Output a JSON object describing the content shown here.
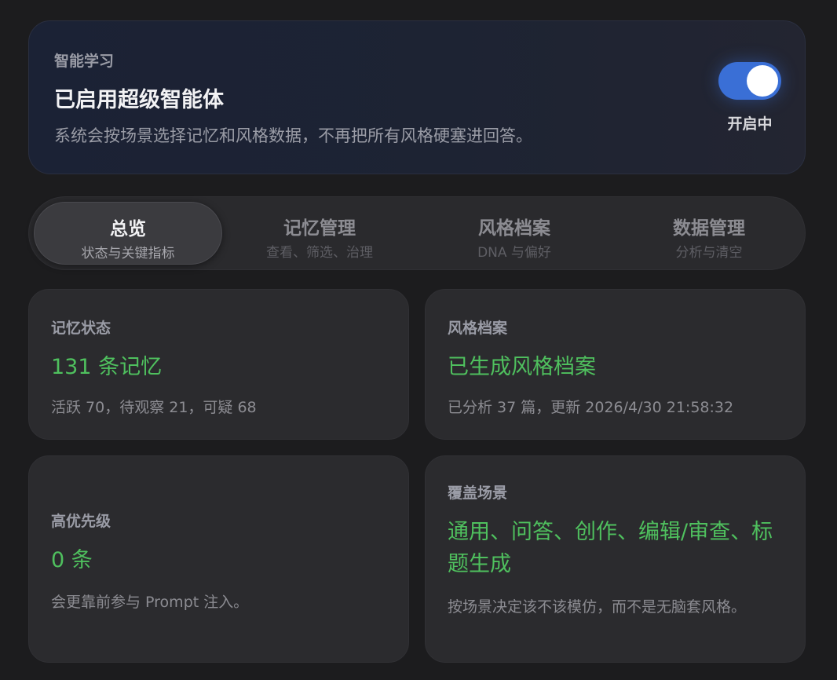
{
  "hero": {
    "eyebrow": "智能学习",
    "title": "已启用超级智能体",
    "description": "系统会按场景选择记忆和风格数据，不再把所有风格硬塞进回答。",
    "toggle_state_label": "开启中",
    "toggle_on": true,
    "accent_color": "#3a6fd6"
  },
  "tabs": [
    {
      "label": "总览",
      "sub": "状态与关键指标",
      "active": true
    },
    {
      "label": "记忆管理",
      "sub": "查看、筛选、治理",
      "active": false
    },
    {
      "label": "风格档案",
      "sub": "DNA 与偏好",
      "active": false
    },
    {
      "label": "数据管理",
      "sub": "分析与清空",
      "active": false
    }
  ],
  "cards": {
    "memory": {
      "label": "记忆状态",
      "value": "131 条记忆",
      "note": "活跃 70，待观察 21，可疑 68"
    },
    "style": {
      "label": "风格档案",
      "value": "已生成风格档案",
      "note": "已分析 37 篇，更新 2026/4/30 21:58:32"
    },
    "priority": {
      "label": "高优先级",
      "value": "0 条",
      "note": "会更靠前参与 Prompt 注入。"
    },
    "scenes": {
      "label": "覆盖场景",
      "value": "通用、问答、创作、编辑/审查、标题生成",
      "note": "按场景决定该不该模仿，而不是无脑套风格。"
    }
  },
  "colors": {
    "success": "#4fc05e",
    "background": "#1c1c1e",
    "card": "#2b2b2e"
  }
}
